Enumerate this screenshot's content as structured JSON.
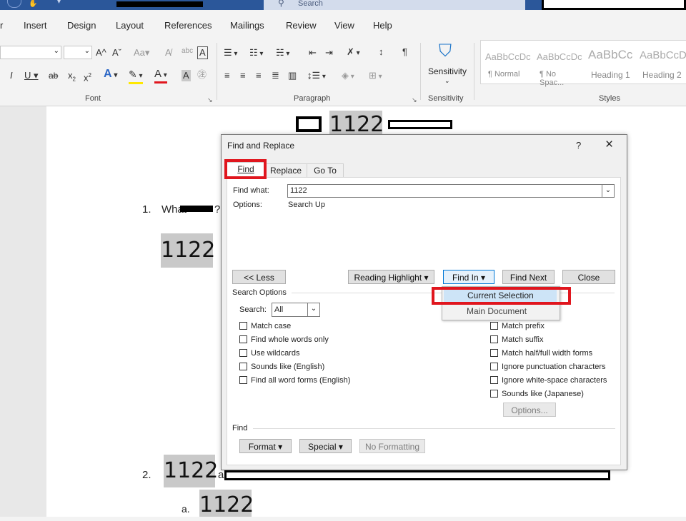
{
  "titlebar": {
    "search_label": "Search"
  },
  "menubar": {
    "items": [
      "r",
      "Insert",
      "Design",
      "Layout",
      "References",
      "Mailings",
      "Review",
      "View",
      "Help"
    ]
  },
  "ribbon": {
    "groups": {
      "font": "Font",
      "paragraph": "Paragraph",
      "sensitivity": "Sensitivity",
      "styles": "Styles"
    },
    "sensitivity_button": "Sensitivity",
    "styles": [
      {
        "preview": "AaBbCcDc",
        "name": "¶ Normal"
      },
      {
        "preview": "AaBbCcDc",
        "name": "¶ No Spac..."
      },
      {
        "preview": "AaBbCc",
        "name": "Heading 1"
      },
      {
        "preview": "AaBbCcD",
        "name": "Heading 2"
      }
    ]
  },
  "document": {
    "title_num": "1122",
    "item1_num": "1.",
    "item1_text": "What",
    "item1_q": "?",
    "item1_hl": "1122",
    "item2_num": "2.",
    "item2_hl": "1122",
    "item2_text": "a",
    "itema_num": "a.",
    "itema_hl": "1122"
  },
  "dialog": {
    "title": "Find and Replace",
    "help": "?",
    "close": "×",
    "tabs": [
      "Find",
      "Replace",
      "Go To"
    ],
    "find_what_label": "Find what:",
    "find_what_value": "1122",
    "options_label": "Options:",
    "options_value": "Search Up",
    "buttons": {
      "less": "<< Less",
      "reading_highlight": "Reading Highlight ▾",
      "find_in": "Find In ▾",
      "find_next": "Find Next",
      "close": "Close"
    },
    "search_options_label": "Search Options",
    "search_label": "Search:",
    "search_value": "All",
    "left_options": [
      "Match case",
      "Find whole words only",
      "Use wildcards",
      "Sounds like (English)",
      "Find all word forms (English)"
    ],
    "right_options": [
      "Match prefix",
      "Match suffix",
      "Match half/full width forms",
      "Ignore punctuation characters",
      "Ignore white-space characters",
      "Sounds like (Japanese)"
    ],
    "options_button": "Options...",
    "find_section_label": "Find",
    "format_button": "Format ▾",
    "special_button": "Special ▾",
    "no_formatting_button": "No Formatting",
    "find_in_menu": [
      "Current Selection",
      "Main Document"
    ]
  }
}
